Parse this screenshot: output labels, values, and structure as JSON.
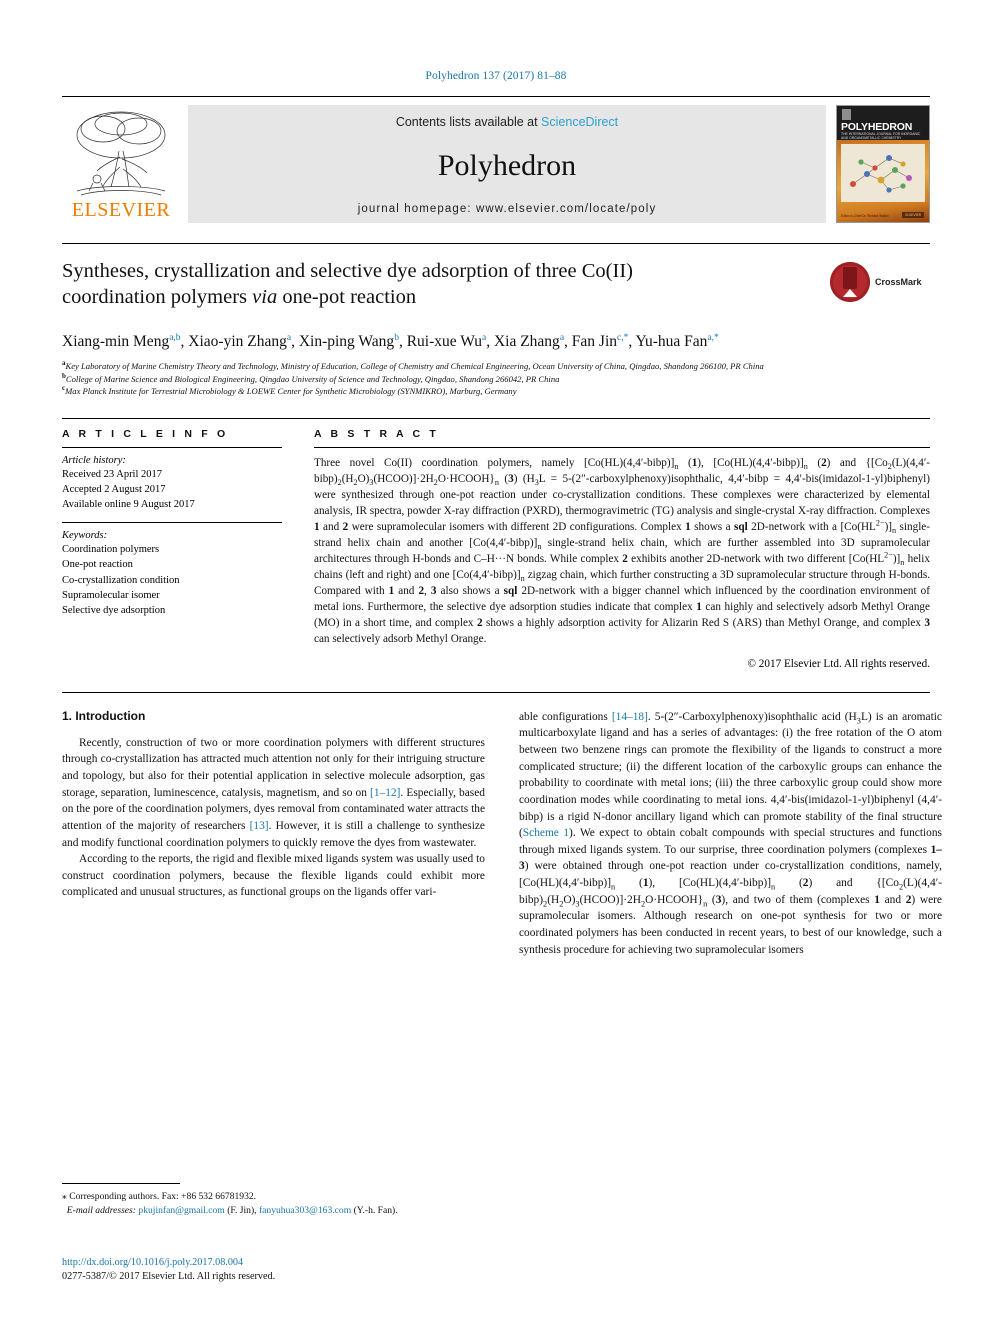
{
  "running_head": "Polyhedron 137 (2017) 81–88",
  "masthead": {
    "contents_prefix": "Contents lists available at ",
    "sciencedirect": "ScienceDirect",
    "journal_name": "Polyhedron",
    "homepage": "journal homepage: www.elsevier.com/locate/poly",
    "publisher": "ELSEVIER",
    "cover": {
      "title": "POLYHEDRON",
      "subtitle": "THE INTERNATIONAL JOURNAL FOR INORGANIC AND ORGANOMETALLIC CHEMISTRY",
      "footer": "Editor-in-Chief\nDr. Richard Walton",
      "badge": "ELSEVIER"
    }
  },
  "article": {
    "title_line1": "Syntheses, crystallization and selective dye adsorption of three Co(II)",
    "title_line2_pre": "coordination polymers ",
    "title_line2_italic": "via",
    "title_line2_post": " one-pot reaction",
    "crossmark_label": "CrossMark",
    "authors": [
      {
        "name": "Xiang-min Meng",
        "sup": "a,b"
      },
      {
        "name": "Xiao-yin Zhang",
        "sup": "a"
      },
      {
        "name": "Xin-ping Wang",
        "sup": "b"
      },
      {
        "name": "Rui-xue Wu",
        "sup": "a"
      },
      {
        "name": "Xia Zhang",
        "sup": "a"
      },
      {
        "name": "Fan Jin",
        "sup": "c,*"
      },
      {
        "name": "Yu-hua Fan",
        "sup": "a,*"
      }
    ],
    "affiliations": [
      {
        "marker": "a",
        "text": "Key Laboratory of Marine Chemistry Theory and Technology, Ministry of Education, College of Chemistry and Chemical Engineering, Ocean University of China, Qingdao, Shandong 266100, PR China"
      },
      {
        "marker": "b",
        "text": "College of Marine Science and Biological Engineering, Qingdao University of Science and Technology, Qingdao, Shandong 266042, PR China"
      },
      {
        "marker": "c",
        "text": "Max Planck Institute for Terrestrial Microbiology & LOEWE Center for Synthetic Microbiology (SYNMIKRO), Marburg, Germany"
      }
    ]
  },
  "article_info": {
    "label": "A R T I C L E  I N F O",
    "history_title": "Article history:",
    "history": [
      "Received 23 April 2017",
      "Accepted 2 August 2017",
      "Available online 9 August 2017"
    ],
    "keywords_title": "Keywords:",
    "keywords": [
      "Coordination polymers",
      "One-pot reaction",
      "Co-crystallization condition",
      "Supramolecular isomer",
      "Selective dye adsorption"
    ]
  },
  "abstract": {
    "label": "A B S T R A C T",
    "copyright": "© 2017 Elsevier Ltd. All rights reserved."
  },
  "introduction": {
    "heading": "1. Introduction"
  },
  "footnotes": {
    "corresponding": "⁎ Corresponding authors. Fax: +86 532 66781932.",
    "email_label": "E-mail addresses:",
    "email1": "pkujinfan@gmail.com",
    "email1_owner": "(F. Jin),",
    "email2": "fanyuhua303@163.com",
    "email2_owner": "(Y.-h. Fan).",
    "doi": "http://dx.doi.org/10.1016/j.poly.2017.08.004",
    "issn": "0277-5387/© 2017 Elsevier Ltd. All rights reserved."
  }
}
